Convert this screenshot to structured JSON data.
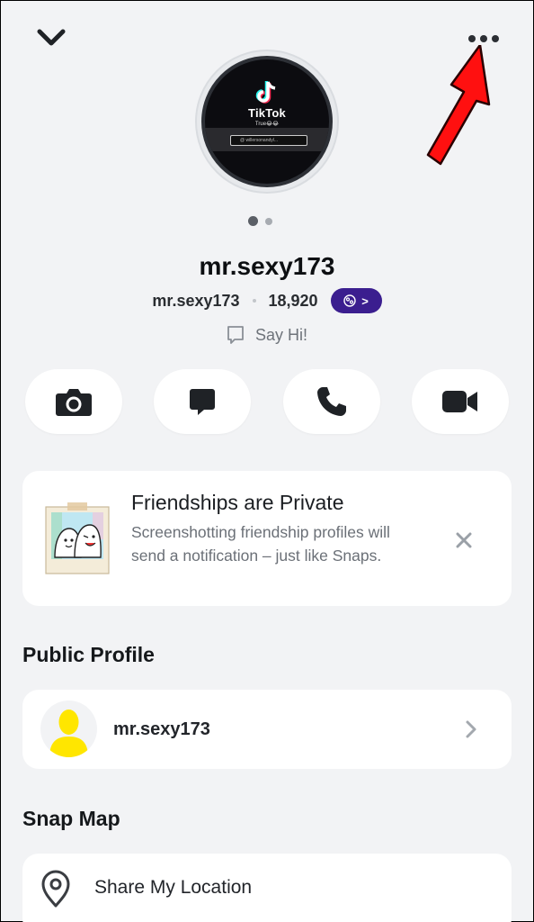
{
  "header": {
    "back_icon": "chevron-down-icon",
    "more_icon": "more-horizontal-icon"
  },
  "annotation": {
    "arrow_color": "#ff0000"
  },
  "profile": {
    "avatar_image": {
      "brand": "TikTok",
      "caption": "True😂😂",
      "handle": "@ willersonandyl..."
    },
    "display_name": "mr.sexy173",
    "username": "mr.sexy173",
    "snap_score": "18,920",
    "zodiac_icon": "cancer-zodiac-icon",
    "zodiac_chevron": ">",
    "say_hi": "Say Hi!"
  },
  "actions": [
    {
      "name": "camera",
      "icon": "camera-icon"
    },
    {
      "name": "chat",
      "icon": "chat-icon"
    },
    {
      "name": "call",
      "icon": "phone-icon"
    },
    {
      "name": "video",
      "icon": "video-icon"
    }
  ],
  "privacy_card": {
    "title": "Friendships are Private",
    "body": "Screenshotting friendship profiles will send a notification – just like Snaps."
  },
  "public_profile": {
    "heading": "Public Profile",
    "name": "mr.sexy173"
  },
  "snap_map": {
    "heading": "Snap Map",
    "share_label": "Share My Location"
  },
  "colors": {
    "background": "#f2f3f5",
    "zodiac_pill": "#3b1e8f",
    "bitmoji_yellow": "#ffe600"
  }
}
